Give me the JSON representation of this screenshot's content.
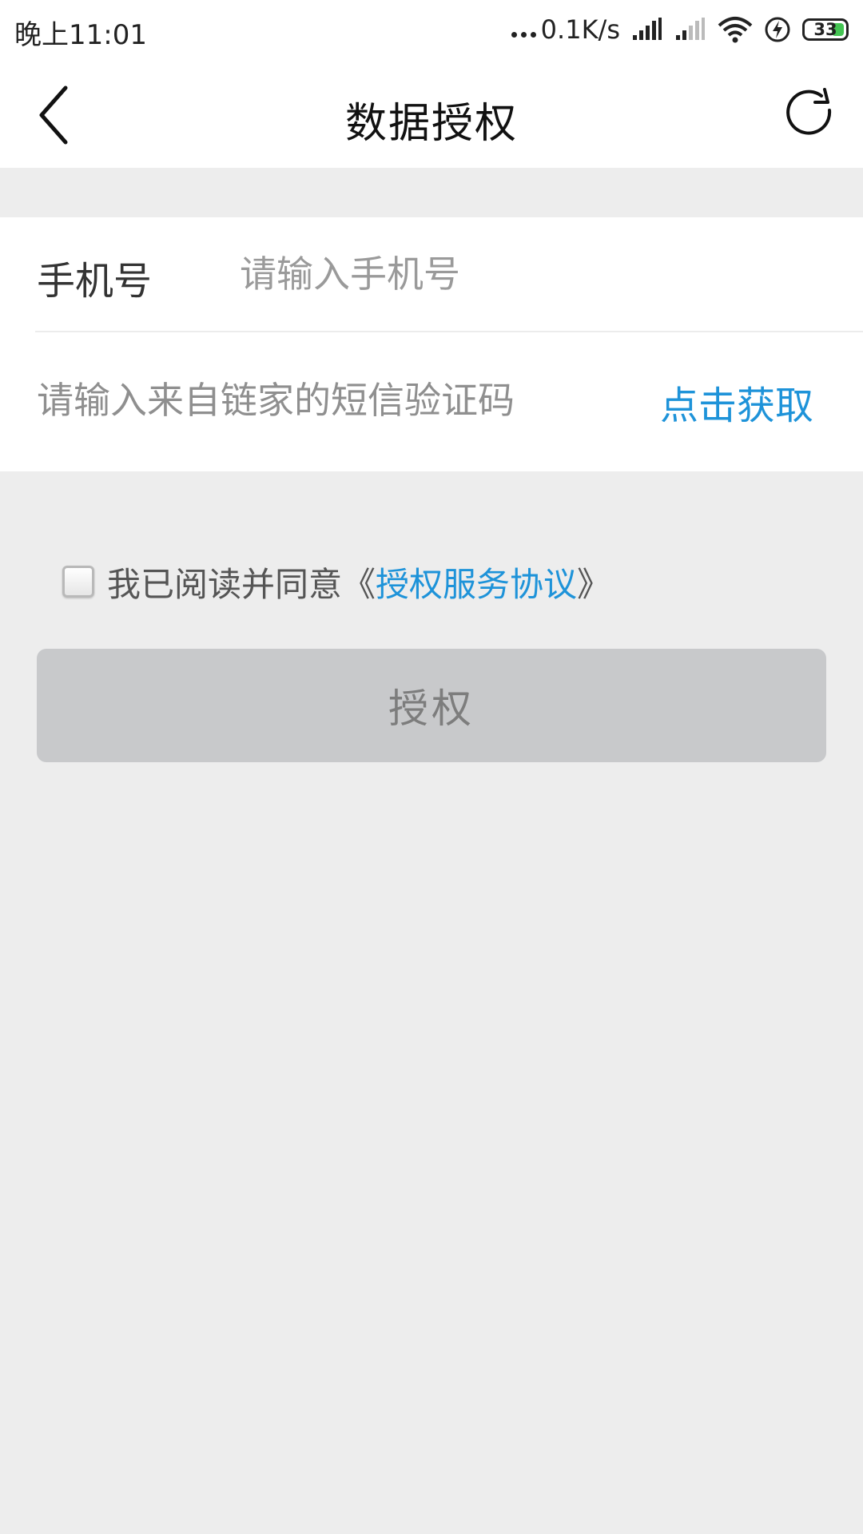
{
  "status_bar": {
    "time": "晚上11:01",
    "net_speed": "0.1K/s",
    "battery_level": "33",
    "battery_fill_color": "#44c553",
    "icons": [
      "more-dots-icon",
      "signal-icon",
      "signal-weak-icon",
      "wifi-icon",
      "charging-icon",
      "battery-icon"
    ]
  },
  "header": {
    "title": "数据授权",
    "back_icon": "chevron-left-icon",
    "refresh_icon": "refresh-icon"
  },
  "form": {
    "phone": {
      "label": "手机号",
      "placeholder": "请输入手机号",
      "value": ""
    },
    "sms_code": {
      "placeholder": "请输入来自链家的短信验证码",
      "value": "",
      "get_code_label": "点击获取"
    }
  },
  "agreement": {
    "checked": false,
    "prefix": "我已阅读并同意《",
    "link_text": "授权服务协议",
    "suffix": "》"
  },
  "submit": {
    "label": "授权",
    "enabled": false
  },
  "colors": {
    "accent": "#1e93d9",
    "page_bg": "#ededed",
    "button_disabled_bg": "#c8c9cb"
  }
}
